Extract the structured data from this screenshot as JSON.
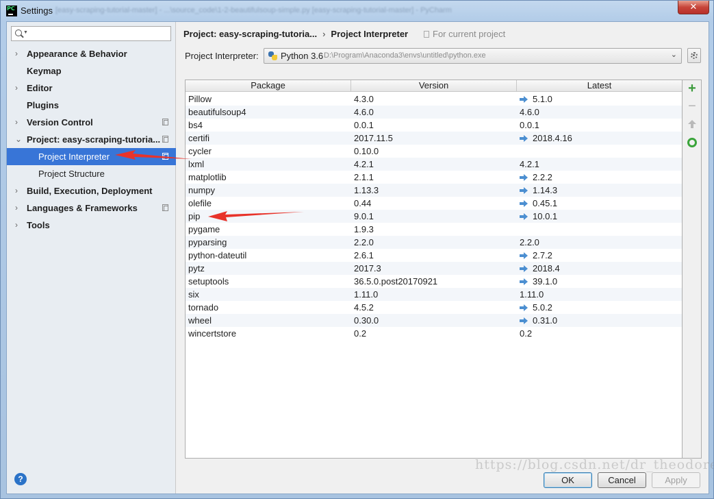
{
  "window": {
    "title": "Settings",
    "blurred_title": "[easy-scraping-tutorial-master] - ...\\source_code\\1-2-beautifulsoup-simple.py [easy-scraping-tutorial-master] - PyCharm",
    "close_glyph": "✕"
  },
  "sidebar": {
    "search_placeholder": "",
    "items": [
      {
        "label": "Appearance & Behavior",
        "arrow": "›",
        "copy": false
      },
      {
        "label": "Keymap",
        "arrow": "",
        "copy": false
      },
      {
        "label": "Editor",
        "arrow": "›",
        "copy": false
      },
      {
        "label": "Plugins",
        "arrow": "",
        "copy": false
      },
      {
        "label": "Version Control",
        "arrow": "›",
        "copy": true
      },
      {
        "label": "Project: easy-scraping-tutoria...",
        "arrow": "⌄",
        "copy": true
      },
      {
        "label": "Project Interpreter",
        "arrow": "",
        "copy": true,
        "selected": true
      },
      {
        "label": "Project Structure",
        "arrow": "",
        "copy": false
      },
      {
        "label": "Build, Execution, Deployment",
        "arrow": "›",
        "copy": false
      },
      {
        "label": "Languages & Frameworks",
        "arrow": "›",
        "copy": true
      },
      {
        "label": "Tools",
        "arrow": "›",
        "copy": false
      }
    ]
  },
  "breadcrumb": {
    "project": "Project: easy-scraping-tutoria...",
    "separator": "›",
    "page": "Project Interpreter",
    "scope": "For current project"
  },
  "interpreter": {
    "label": "Project Interpreter:",
    "name": "Python 3.6",
    "path": "D:\\Program\\Anaconda3\\envs\\untitled\\python.exe",
    "chevron": "⌄"
  },
  "table": {
    "columns": [
      "Package",
      "Version",
      "Latest"
    ],
    "rows": [
      {
        "package": "Pillow",
        "version": "4.3.0",
        "latest": "5.1.0",
        "upgrade": true
      },
      {
        "package": "beautifulsoup4",
        "version": "4.6.0",
        "latest": "4.6.0",
        "upgrade": false
      },
      {
        "package": "bs4",
        "version": "0.0.1",
        "latest": "0.0.1",
        "upgrade": false
      },
      {
        "package": "certifi",
        "version": "2017.11.5",
        "latest": "2018.4.16",
        "upgrade": true
      },
      {
        "package": "cycler",
        "version": "0.10.0",
        "latest": "",
        "upgrade": false
      },
      {
        "package": "lxml",
        "version": "4.2.1",
        "latest": "4.2.1",
        "upgrade": false
      },
      {
        "package": "matplotlib",
        "version": "2.1.1",
        "latest": "2.2.2",
        "upgrade": true
      },
      {
        "package": "numpy",
        "version": "1.13.3",
        "latest": "1.14.3",
        "upgrade": true
      },
      {
        "package": "olefile",
        "version": "0.44",
        "latest": "0.45.1",
        "upgrade": true
      },
      {
        "package": "pip",
        "version": "9.0.1",
        "latest": "10.0.1",
        "upgrade": true
      },
      {
        "package": "pygame",
        "version": "1.9.3",
        "latest": "",
        "upgrade": false
      },
      {
        "package": "pyparsing",
        "version": "2.2.0",
        "latest": "2.2.0",
        "upgrade": false
      },
      {
        "package": "python-dateutil",
        "version": "2.6.1",
        "latest": "2.7.2",
        "upgrade": true
      },
      {
        "package": "pytz",
        "version": "2017.3",
        "latest": "2018.4",
        "upgrade": true
      },
      {
        "package": "setuptools",
        "version": "36.5.0.post20170921",
        "latest": "39.1.0",
        "upgrade": true
      },
      {
        "package": "six",
        "version": "1.11.0",
        "latest": "1.11.0",
        "upgrade": false
      },
      {
        "package": "tornado",
        "version": "4.5.2",
        "latest": "5.0.2",
        "upgrade": true
      },
      {
        "package": "wheel",
        "version": "0.30.0",
        "latest": "0.31.0",
        "upgrade": true
      },
      {
        "package": "wincertstore",
        "version": "0.2",
        "latest": "0.2",
        "upgrade": false
      }
    ]
  },
  "toolbar": {
    "add": "+",
    "remove": "−"
  },
  "footer": {
    "help": "?",
    "ok": "OK",
    "cancel": "Cancel",
    "apply": "Apply",
    "watermark": "https://blog.csdn.net/dr_theodore"
  },
  "colors": {
    "selection": "#3875d7",
    "upgrade_arrow": "#4c8fd1",
    "add": "#3b9a3b",
    "annotation": "#e8332a"
  }
}
